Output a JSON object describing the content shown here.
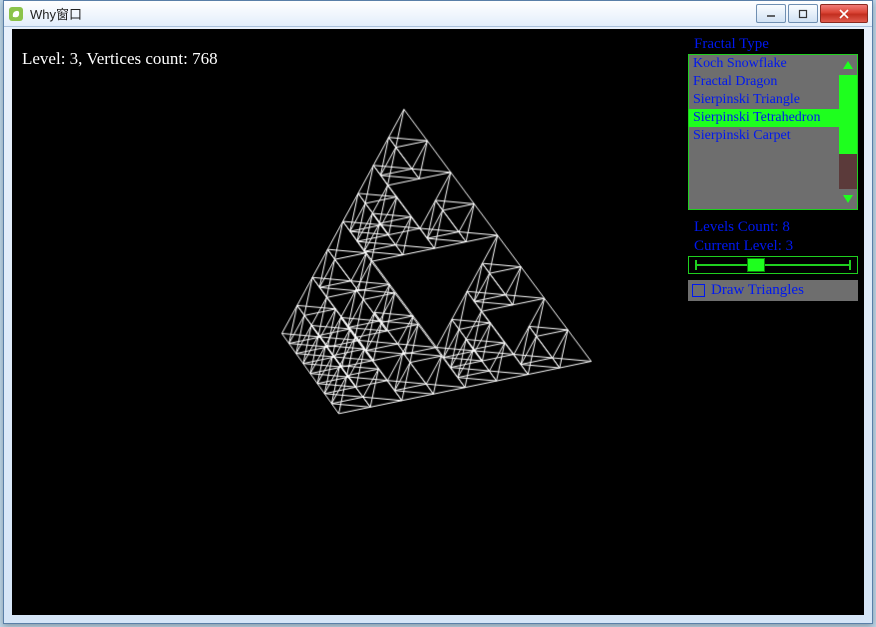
{
  "window": {
    "title": "Why窗口"
  },
  "hud": {
    "text": "Level: 3, Vertices count: 768"
  },
  "panel": {
    "fractal_type_label": "Fractal Type",
    "items": [
      "Koch Snowflake",
      "Fractal Dragon",
      "Sierpinski Triangle",
      "Sierpinski Tetrahedron",
      "Sierpinski Carpet"
    ],
    "selected_index": 3,
    "levels_count_label": "Levels Count: 8",
    "current_level_label": "Current Level: 3",
    "slider": {
      "min": 0,
      "max": 8,
      "value": 3
    },
    "draw_triangles_label": "Draw Triangles",
    "draw_triangles_checked": false
  },
  "colors": {
    "accent_green": "#1eff1e",
    "accent_blue": "#0018f0"
  }
}
